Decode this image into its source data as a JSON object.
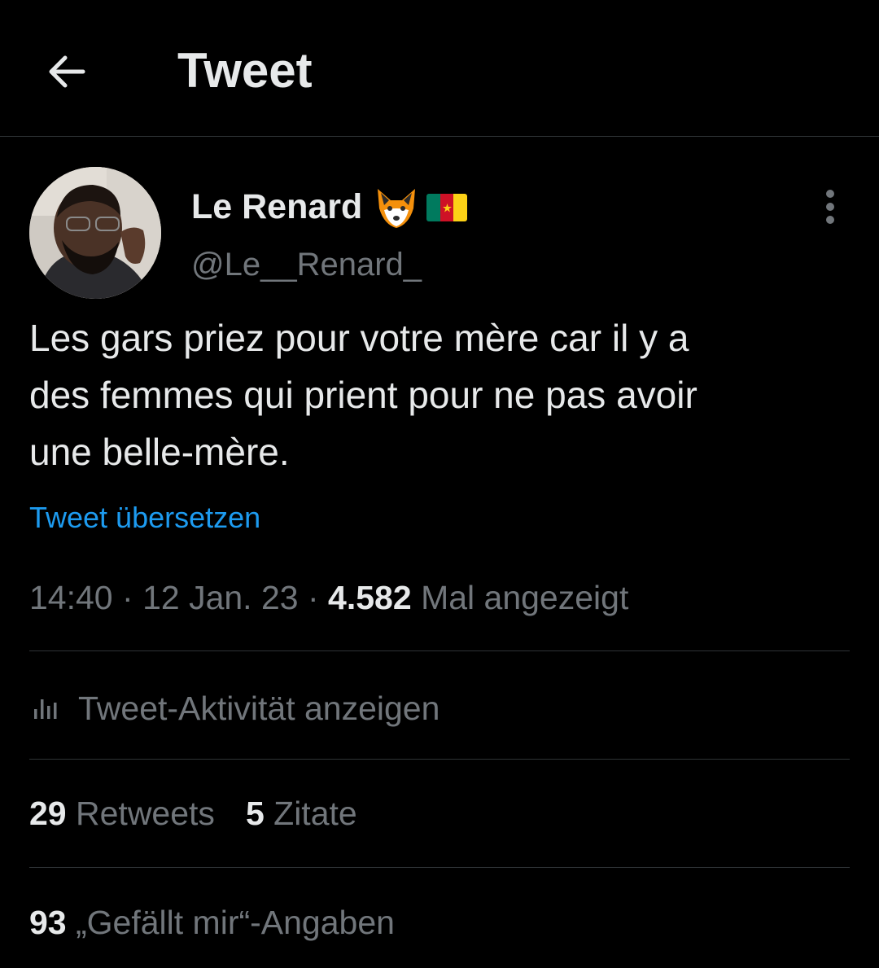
{
  "header": {
    "title": "Tweet",
    "back_icon": "arrow-left-icon"
  },
  "author": {
    "display_name": "Le Renard",
    "emoji_icons": [
      "fox-face-icon",
      "cameroon-flag-icon"
    ],
    "handle": "@Le__Renard_",
    "more_icon": "more-vertical-icon"
  },
  "tweet": {
    "lines": [
      "Les gars priez pour votre mère car il y a",
      "des femmes qui prient pour ne pas avoir",
      "une belle-mère."
    ],
    "translate_label": "Tweet übersetzen"
  },
  "meta": {
    "time": "14:40",
    "separator": "·",
    "date": "12 Jan. 23",
    "views_count": "4.582",
    "views_label": "Mal angezeigt"
  },
  "activity": {
    "label": "Tweet-Aktivität anzeigen",
    "icon": "bar-chart-icon"
  },
  "stats": {
    "retweets_count": "29",
    "retweets_label": "Retweets",
    "quotes_count": "5",
    "quotes_label": "Zitate",
    "likes_count": "93",
    "likes_label": "„Gefällt mir“-Angaben"
  },
  "colors": {
    "background": "#000000",
    "text_primary": "#e7e9ea",
    "text_secondary": "#71767b",
    "link": "#1d9bf0",
    "divider": "#2f3336"
  }
}
